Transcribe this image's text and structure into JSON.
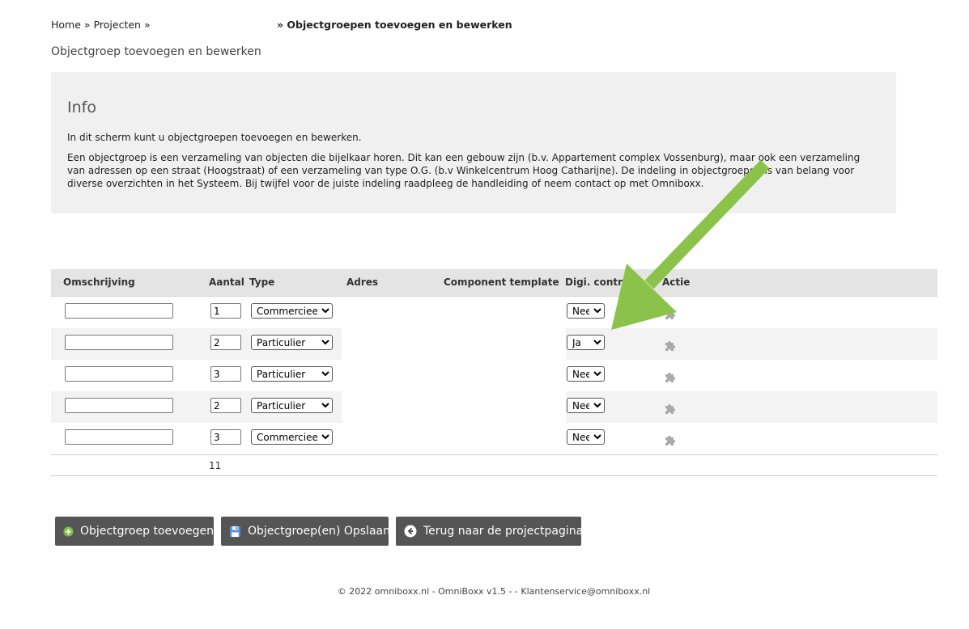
{
  "breadcrumb": {
    "home": "Home",
    "sep": "»",
    "projects": "Projecten",
    "current": "» Objectgroepen toevoegen en bewerken"
  },
  "page_title": "Objectgroep toevoegen en bewerken",
  "info": {
    "heading": "Info",
    "paragraph1": "In dit scherm kunt u objectgroepen toevoegen en bewerken.",
    "paragraph2": "Een objectgroep is een verzameling van objecten die bijelkaar horen. Dit kan een gebouw zijn (b.v. Appartement complex Vossenburg), maar ook een verzameling van adressen op een straat (Hoogstraat) of een verzameling van type O.G. (b.v Winkelcentrum Hoog Catharijne). De indeling in objectgroepen is van belang voor diverse overzichten in het Systeem. Bij twijfel voor de juiste indeling raadpleeg de handleiding of neem contact op met Omniboxx."
  },
  "table": {
    "headers": {
      "omschrijving": "Omschrijving",
      "aantal": "Aantal",
      "type": "Type",
      "adres": "Adres",
      "component": "Component template",
      "digi": "Digi. contract",
      "actie": "Actie"
    },
    "type_options": [
      "Commercieel",
      "Particulier"
    ],
    "digi_options": [
      "Nee",
      "Ja"
    ],
    "rows": [
      {
        "omschrijving": "",
        "aantal": "1",
        "type": "Commercieel",
        "digi": "Nee"
      },
      {
        "omschrijving": "",
        "aantal": "2",
        "type": "Particulier",
        "digi": "Ja"
      },
      {
        "omschrijving": "",
        "aantal": "3",
        "type": "Particulier",
        "digi": "Nee"
      },
      {
        "omschrijving": "",
        "aantal": "2",
        "type": "Particulier",
        "digi": "Nee"
      },
      {
        "omschrijving": "",
        "aantal": "3",
        "type": "Commercieel",
        "digi": "Nee"
      }
    ],
    "total": "11"
  },
  "buttons": {
    "add": "Objectgroep toevoegen",
    "save": "Objectgroep(en) Opslaan",
    "back": "Terug naar de projectpagina"
  },
  "footer": {
    "text": "© 2022 omniboxx.nl - ",
    "brand": "OmniBoxx v1.5",
    "rest": " - - Klantenservice@omniboxx.nl"
  },
  "colors": {
    "button_bg": "#555555",
    "header_bg": "#e4e4e4",
    "info_bg": "#f0f0f0",
    "arrow": "#8bc34a"
  },
  "icons": {
    "add": "plus-circle-icon",
    "save": "floppy-disk-icon",
    "back": "arrow-left-circle-icon",
    "action": "puzzle-icon"
  }
}
